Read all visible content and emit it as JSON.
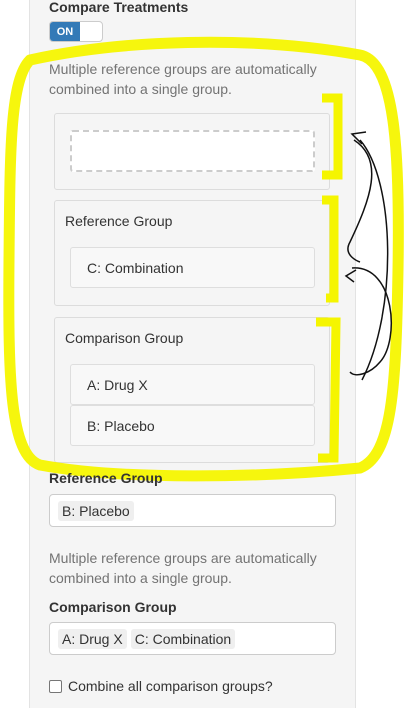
{
  "header": {
    "compare_label": "Compare Treatments",
    "switch_label": "ON"
  },
  "top_help": {
    "line1": "Multiple reference groups are automatically",
    "line2": "combined into a single group."
  },
  "drag_area": {
    "reference_label": "Reference Group",
    "reference_items": [
      "C: Combination"
    ],
    "comparison_label": "Comparison Group",
    "comparison_items": [
      "A: Drug X",
      "B: Placebo"
    ]
  },
  "reference_select": {
    "label": "Reference Group",
    "tags": [
      "B: Placebo"
    ]
  },
  "bottom_help": {
    "line1": "Multiple reference groups are automatically",
    "line2": "combined into a single group."
  },
  "comparison_select": {
    "label": "Comparison Group",
    "tags": [
      "A: Drug X",
      "C: Combination"
    ]
  },
  "combine_checkbox": {
    "label": "Combine all comparison groups?"
  },
  "colors": {
    "highlight": "#f5f500",
    "switch_on": "#337ab7",
    "panel_bg": "#f5f5f5"
  }
}
